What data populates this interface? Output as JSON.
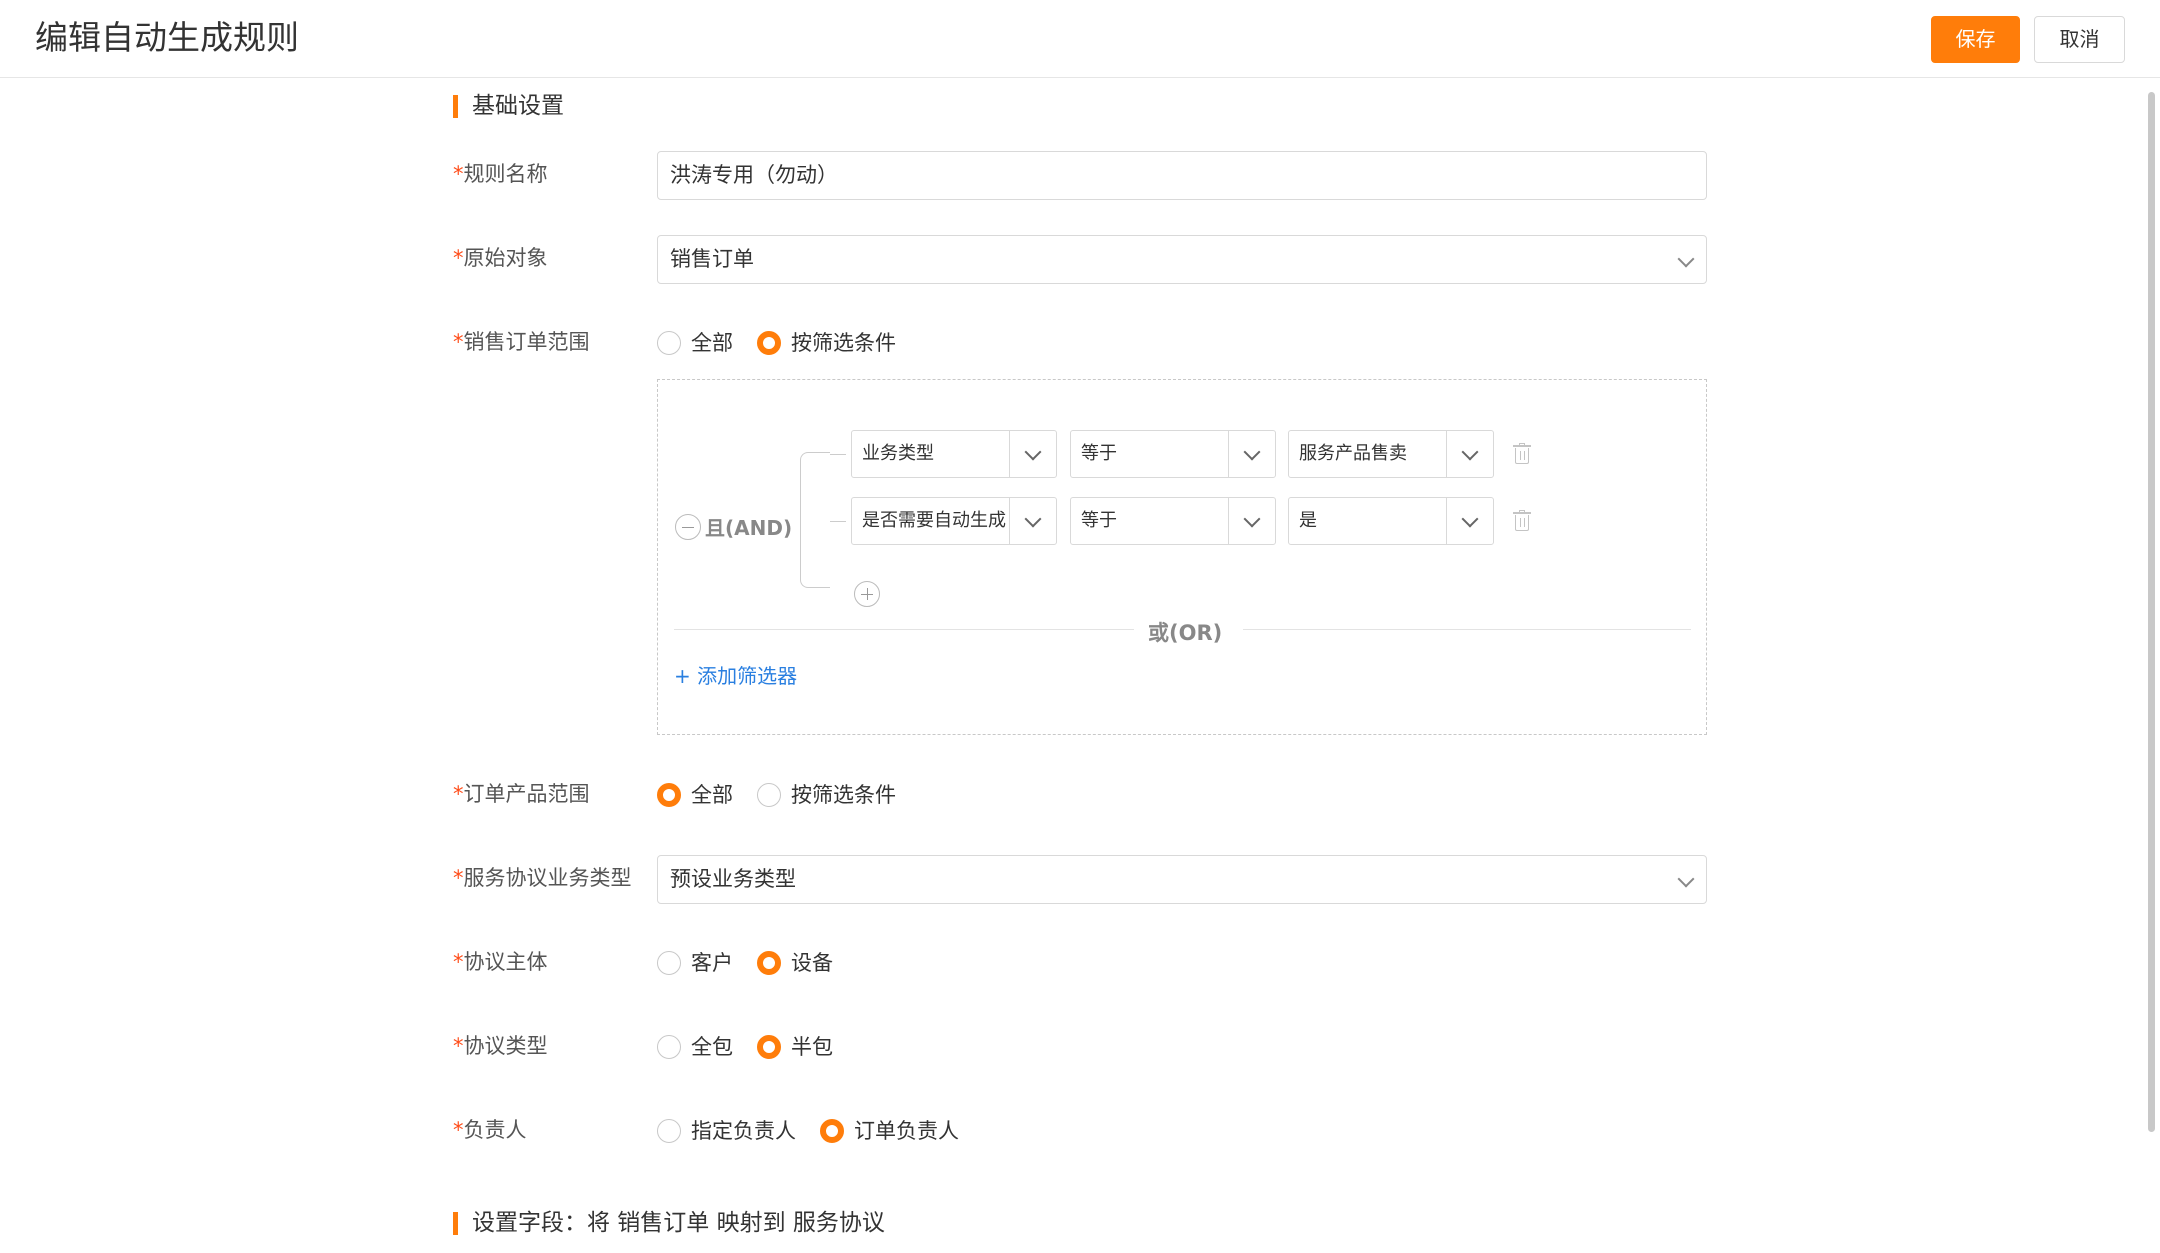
{
  "header": {
    "title": "编辑自动生成规则",
    "save_label": "保存",
    "cancel_label": "取消"
  },
  "sections": {
    "basic": "基础设置",
    "mapping": "设置字段：将 销售订单 映射到 服务协议"
  },
  "form": {
    "required_mark": "*",
    "rule_name": {
      "label": "规则名称",
      "value": "洪涛专用（勿动）"
    },
    "source_object": {
      "label": "原始对象",
      "value": "销售订单"
    },
    "order_scope": {
      "label": "销售订单范围",
      "options": [
        "全部",
        "按筛选条件"
      ],
      "selected": "按筛选条件"
    },
    "product_scope": {
      "label": "订单产品范围",
      "options": [
        "全部",
        "按筛选条件"
      ],
      "selected": "全部"
    },
    "service_type": {
      "label": "服务协议业务类型",
      "value": "预设业务类型"
    },
    "subject": {
      "label": "协议主体",
      "options": [
        "客户",
        "设备"
      ],
      "selected": "设备"
    },
    "agreement_type": {
      "label": "协议类型",
      "options": [
        "全包",
        "半包"
      ],
      "selected": "半包"
    },
    "owner": {
      "label": "负责人",
      "options": [
        "指定负责人",
        "订单负责人"
      ],
      "selected": "订单负责人"
    }
  },
  "filter": {
    "and_label": "且(AND)",
    "or_label": "或(OR)",
    "add_filter_label": "+ 添加筛选器",
    "conditions": [
      {
        "field": "业务类型",
        "operator": "等于",
        "value": "服务产品售卖"
      },
      {
        "field": "是否需要自动生成",
        "operator": "等于",
        "value": "是"
      }
    ]
  },
  "colors": {
    "accent": "#ff7d0a",
    "link": "#2a7fe0",
    "required": "#ff4d1a"
  },
  "icons": [
    "chevron-down-icon",
    "trash-icon",
    "minus-circle-icon",
    "plus-circle-icon"
  ]
}
